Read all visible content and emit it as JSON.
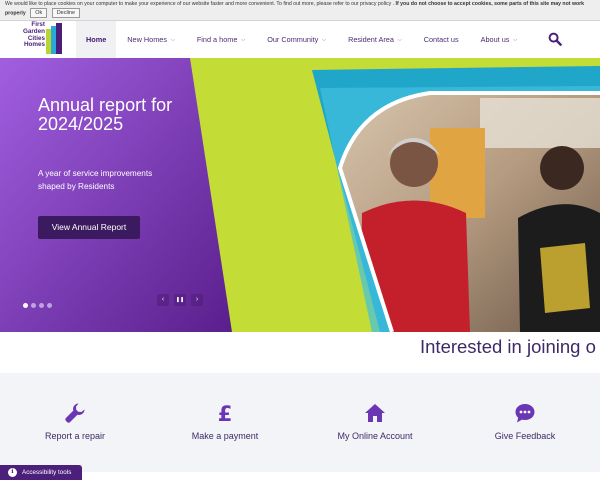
{
  "cookie_bar": {
    "message": "We would like to place cookies on your computer to make your experience of our website faster and more convenient. To find out more, please refer to our privacy policy .",
    "warning": "If you do not choose to accept cookies, some parts of this site may not work properly",
    "ok_label": "Ok",
    "decline_label": "Decline"
  },
  "logo": {
    "lines": [
      "First",
      "Garden",
      "Cities",
      "Homes"
    ]
  },
  "nav": {
    "items": [
      {
        "label": "Home",
        "active": true,
        "has_chevron": false
      },
      {
        "label": "New Homes",
        "has_chevron": true
      },
      {
        "label": "Find a home",
        "has_chevron": true
      },
      {
        "label": "Our Community",
        "has_chevron": true
      },
      {
        "label": "Resident Area",
        "has_chevron": true
      },
      {
        "label": "Contact us",
        "has_chevron": false
      },
      {
        "label": "About us",
        "has_chevron": true
      }
    ],
    "search_icon": "search-icon"
  },
  "hero": {
    "title": "Annual report for 2024/2025",
    "subtitle": "A year of service improvements shaped by Residents",
    "button": "View Annual Report",
    "slide_count": 4,
    "active_slide": 1,
    "prev_glyph": "‹",
    "pause_glyph": "❚❚",
    "next_glyph": "›",
    "colors": {
      "purple_light": "#a15fe0",
      "purple_dark": "#5a1f8c",
      "lime": "#c3dc36",
      "teal": "#1fa6c9",
      "button": "#3c1a5f"
    }
  },
  "interested": {
    "text": "Interested in joining o"
  },
  "quick_links": [
    {
      "label": "Report a repair",
      "icon": "wrench-icon"
    },
    {
      "label": "Make a payment",
      "icon": "pound-icon"
    },
    {
      "label": "My Online Account",
      "icon": "house-icon"
    },
    {
      "label": "Give Feedback",
      "icon": "chat-bubble-icon"
    }
  ],
  "accessibility": {
    "label": "Accessibility tools",
    "icon": "accessibility-icon"
  }
}
